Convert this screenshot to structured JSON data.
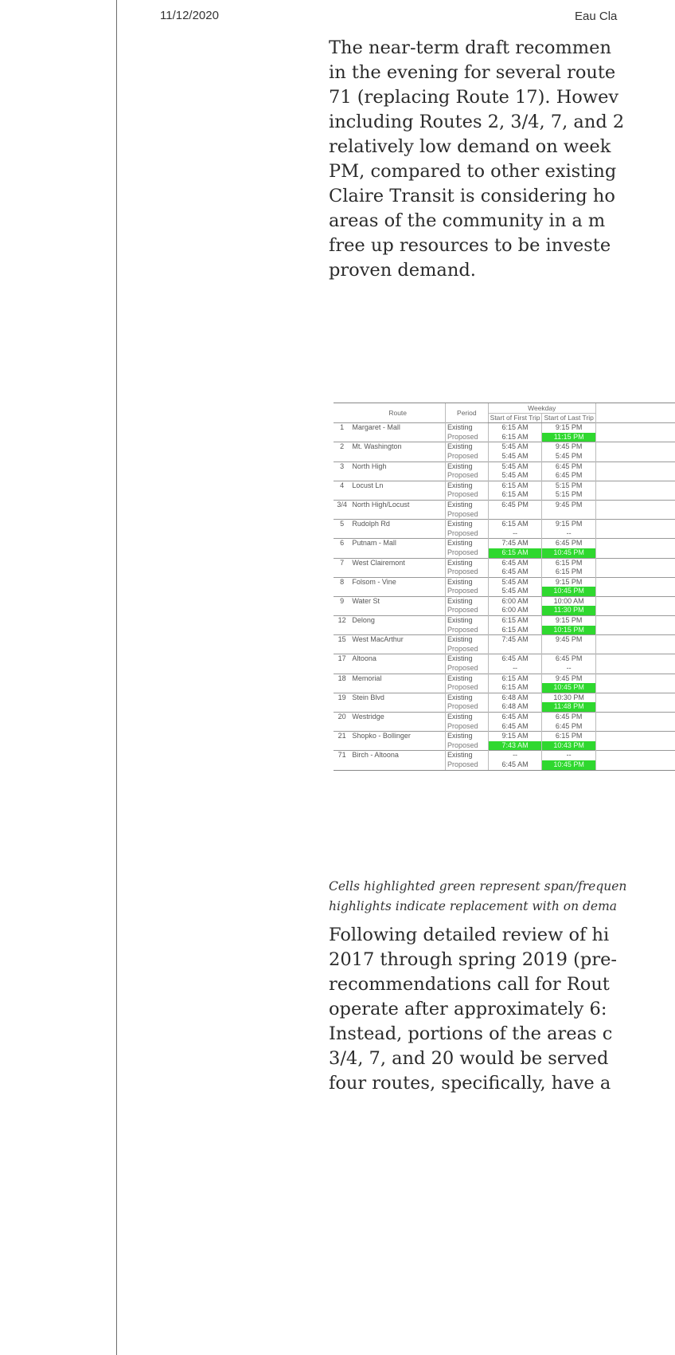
{
  "header": {
    "date": "11/12/2020",
    "title": "Eau Cla"
  },
  "paragraph1": [
    "The near-term draft recommen",
    "in the evening for several route",
    "71 (replacing Route 17). Howev",
    "including Routes 2, 3/4, 7, and 2",
    "relatively low demand on week",
    "PM, compared to other existing",
    "Claire Transit is considering ho",
    "areas of the community in a m",
    "free up resources to be investe",
    "proven demand."
  ],
  "table": {
    "headers": {
      "route": "Route",
      "period": "Period",
      "weekday": "Weekday",
      "first": "Start of First Trip",
      "last": "Start of Last Trip"
    },
    "rows": [
      {
        "num": "1",
        "route": "Margaret - Mall",
        "period": "Existing",
        "first": "6:15 AM",
        "last": "9:15 PM",
        "start": true
      },
      {
        "num": "",
        "route": "",
        "period": "Proposed",
        "first": "6:15 AM",
        "last": "11:15 PM",
        "hl_last": true
      },
      {
        "num": "2",
        "route": "Mt. Washington",
        "period": "Existing",
        "first": "5:45 AM",
        "last": "9:45 PM",
        "start": true
      },
      {
        "num": "",
        "route": "",
        "period": "Proposed",
        "first": "5:45 AM",
        "last": "5:45 PM"
      },
      {
        "num": "3",
        "route": "North High",
        "period": "Existing",
        "first": "5:45 AM",
        "last": "6:45 PM",
        "start": true
      },
      {
        "num": "",
        "route": "",
        "period": "Proposed",
        "first": "5:45 AM",
        "last": "6:45 PM"
      },
      {
        "num": "4",
        "route": "Locust Ln",
        "period": "Existing",
        "first": "6:15 AM",
        "last": "5:15 PM",
        "start": true
      },
      {
        "num": "",
        "route": "",
        "period": "Proposed",
        "first": "6:15 AM",
        "last": "5:15 PM"
      },
      {
        "num": "3/4",
        "route": "North High/Locust",
        "period": "Existing",
        "first": "6:45 PM",
        "last": "9:45 PM",
        "start": true
      },
      {
        "num": "",
        "route": "",
        "period": "Proposed",
        "first": "",
        "last": ""
      },
      {
        "num": "5",
        "route": "Rudolph Rd",
        "period": "Existing",
        "first": "6:15 AM",
        "last": "9:15 PM",
        "start": true
      },
      {
        "num": "",
        "route": "",
        "period": "Proposed",
        "first": "--",
        "last": "--"
      },
      {
        "num": "6",
        "route": "Putnam - Mall",
        "period": "Existing",
        "first": "7:45 AM",
        "last": "6:45 PM",
        "start": true
      },
      {
        "num": "",
        "route": "",
        "period": "Proposed",
        "first": "6:15 AM",
        "last": "10:45 PM",
        "hl_first": true,
        "hl_last": true
      },
      {
        "num": "7",
        "route": "West Clairemont",
        "period": "Existing",
        "first": "6:45 AM",
        "last": "6:15 PM",
        "start": true
      },
      {
        "num": "",
        "route": "",
        "period": "Proposed",
        "first": "6:45 AM",
        "last": "6:15 PM"
      },
      {
        "num": "8",
        "route": "Folsom - Vine",
        "period": "Existing",
        "first": "5:45 AM",
        "last": "9:15 PM",
        "start": true
      },
      {
        "num": "",
        "route": "",
        "period": "Proposed",
        "first": "5:45 AM",
        "last": "10:45 PM",
        "hl_last": true
      },
      {
        "num": "9",
        "route": "Water St",
        "period": "Existing",
        "first": "6:00 AM",
        "last": "10:00 AM",
        "start": true
      },
      {
        "num": "",
        "route": "",
        "period": "Proposed",
        "first": "6:00 AM",
        "last": "11:30 PM",
        "hl_last": true
      },
      {
        "num": "12",
        "route": "Delong",
        "period": "Existing",
        "first": "6:15 AM",
        "last": "9:15 PM",
        "start": true
      },
      {
        "num": "",
        "route": "",
        "period": "Proposed",
        "first": "6:15 AM",
        "last": "10:15 PM",
        "hl_last": true
      },
      {
        "num": "15",
        "route": "West MacArthur",
        "period": "Existing",
        "first": "7:45 AM",
        "last": "9:45 PM",
        "start": true
      },
      {
        "num": "",
        "route": "",
        "period": "Proposed",
        "first": "",
        "last": ""
      },
      {
        "num": "17",
        "route": "Altoona",
        "period": "Existing",
        "first": "6:45 AM",
        "last": "6:45 PM",
        "start": true
      },
      {
        "num": "",
        "route": "",
        "period": "Proposed",
        "first": "--",
        "last": "--"
      },
      {
        "num": "18",
        "route": "Memorial",
        "period": "Existing",
        "first": "6:15 AM",
        "last": "9:45 PM",
        "start": true
      },
      {
        "num": "",
        "route": "",
        "period": "Proposed",
        "first": "6:15 AM",
        "last": "10:45 PM",
        "hl_last": true
      },
      {
        "num": "19",
        "route": "Stein Blvd",
        "period": "Existing",
        "first": "6:48 AM",
        "last": "10:30 PM",
        "start": true
      },
      {
        "num": "",
        "route": "",
        "period": "Proposed",
        "first": "6:48 AM",
        "last": "11:48 PM",
        "hl_last": true
      },
      {
        "num": "20",
        "route": "Westridge",
        "period": "Existing",
        "first": "6:45 AM",
        "last": "6:45 PM",
        "start": true
      },
      {
        "num": "",
        "route": "",
        "period": "Proposed",
        "first": "6:45 AM",
        "last": "6:45 PM"
      },
      {
        "num": "21",
        "route": "Shopko - Bollinger",
        "period": "Existing",
        "first": "9:15 AM",
        "last": "6:15 PM",
        "start": true
      },
      {
        "num": "",
        "route": "",
        "period": "Proposed",
        "first": "7:43 AM",
        "last": "10:43 PM",
        "hl_first": true,
        "hl_last": true
      },
      {
        "num": "71",
        "route": "Birch - Altoona",
        "period": "Existing",
        "first": "--",
        "last": "--",
        "start": true
      },
      {
        "num": "",
        "route": "",
        "period": "Proposed",
        "first": "6:45 AM",
        "last": "10:45 PM",
        "hl_last": true,
        "last_row": true
      }
    ]
  },
  "caption": [
    "Cells highlighted green represent span/frequen",
    "highlights indicate replacement with on dema"
  ],
  "paragraph2": [
    "Following detailed review of hi",
    "2017 through spring 2019 (pre-",
    "recommendations call for Rout",
    "operate after approximately 6:",
    "Instead, portions of the areas c",
    "3/4, 7, and 20 would be served",
    "four routes, specifically, have a"
  ],
  "colors": {
    "highlight": "#2fd82f",
    "rule": "#6d6d6d"
  }
}
